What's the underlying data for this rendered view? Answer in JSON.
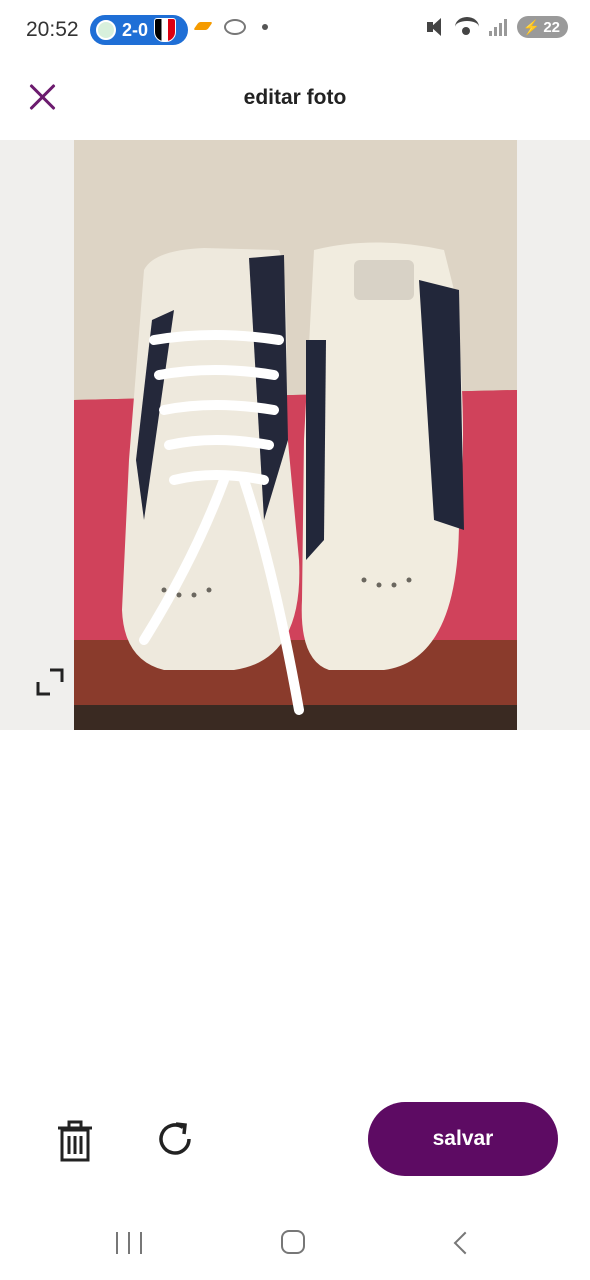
{
  "status_bar": {
    "time": "20:52",
    "score": "2-0",
    "battery": "22"
  },
  "header": {
    "title": "editar foto"
  },
  "photo": {
    "description_icon": "photo-image"
  },
  "toolbar": {
    "save_label": "salvar"
  },
  "colors": {
    "accent": "#5d0b63",
    "close_icon": "#6c1b6e",
    "editor_background": "#f0efed"
  },
  "icons": {
    "close": "close-icon",
    "resize": "resize-icon",
    "trash": "trash-icon",
    "rotate": "rotate-icon",
    "nav_recent": "recent-apps-icon",
    "nav_home": "home-icon",
    "nav_back": "back-icon"
  }
}
